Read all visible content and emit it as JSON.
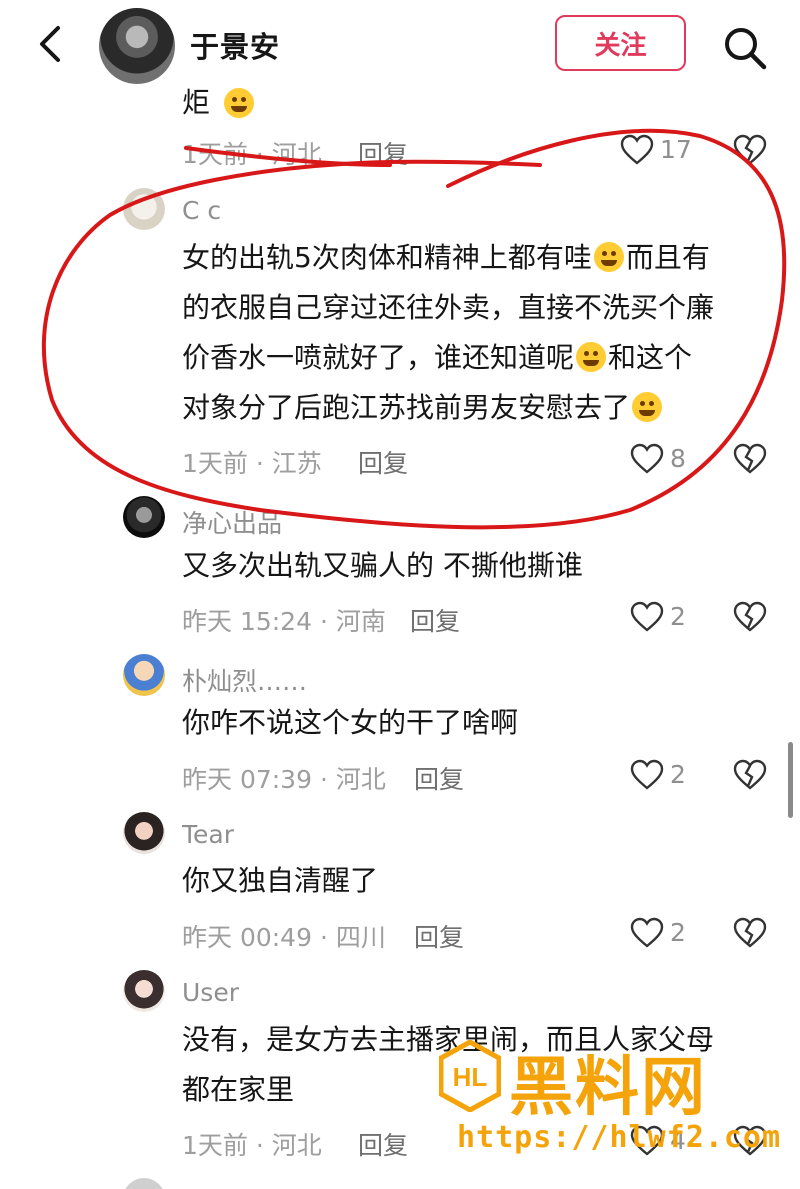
{
  "header": {
    "username": "于景安",
    "follow_label": "关注"
  },
  "colors": {
    "accent": "#e03a5c",
    "annotation": "#d81818",
    "watermark": "#f4a30a"
  },
  "icons": [
    "back-arrow-icon",
    "search-icon",
    "heart-icon",
    "broken-heart-icon",
    "emoji-icon"
  ],
  "comments": [
    {
      "username": "",
      "text": "炬",
      "meta": "1天前 · 河北",
      "reply": "回复",
      "likes": "17"
    },
    {
      "username": "C c",
      "text": "女的出轨5次肉体和精神上都有哇",
      "text2": "而且有\n的衣服自己穿过还往外卖，直接不洗买个廉\n价香水一喷就好了，谁还知道呢",
      "text3": "和这个\n对象分了后跑江苏找前男友安慰去了",
      "meta": "1天前 · 江苏",
      "reply": "回复",
      "likes": "8"
    },
    {
      "username": "净心出品",
      "text": "又多次出轨又骗人的 不撕他撕谁",
      "meta": "昨天 15:24 · 河南",
      "reply": "回复",
      "likes": "2"
    },
    {
      "username": "朴灿烈……",
      "text": "你咋不说这个女的干了啥啊",
      "meta": "昨天 07:39 · 河北",
      "reply": "回复",
      "likes": "2"
    },
    {
      "username": "Tear",
      "text": "你又独自清醒了",
      "meta": "昨天 00:49 · 四川",
      "reply": "回复",
      "likes": "2"
    },
    {
      "username": "User",
      "text": "没有，是女方去主播家里闹，而且人家父母\n都在家里",
      "meta": "1天前 · 河北",
      "reply": "回复",
      "likes": "4"
    }
  ],
  "watermark": {
    "text": "黑料网",
    "url": "https://hlwf2.com"
  }
}
